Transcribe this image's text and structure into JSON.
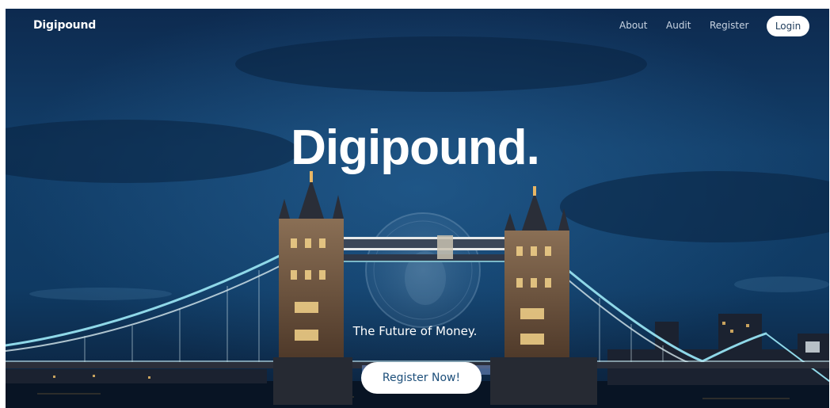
{
  "nav": {
    "brand": "Digipound",
    "links": [
      "About",
      "Audit",
      "Register"
    ],
    "login_label": "Login"
  },
  "hero": {
    "title": "Digipound.",
    "tagline": "The Future of Money.",
    "cta_label": "Register Now!",
    "background_image": "tower-bridge-at-night",
    "coin_image": "pound-coin-watermark"
  },
  "colors": {
    "sky_top": "#0d2a4f",
    "sky_mid": "#134874",
    "water": "#0a1626",
    "button_text": "#1d4f7a",
    "cable_glow": "#8fd8e8"
  }
}
